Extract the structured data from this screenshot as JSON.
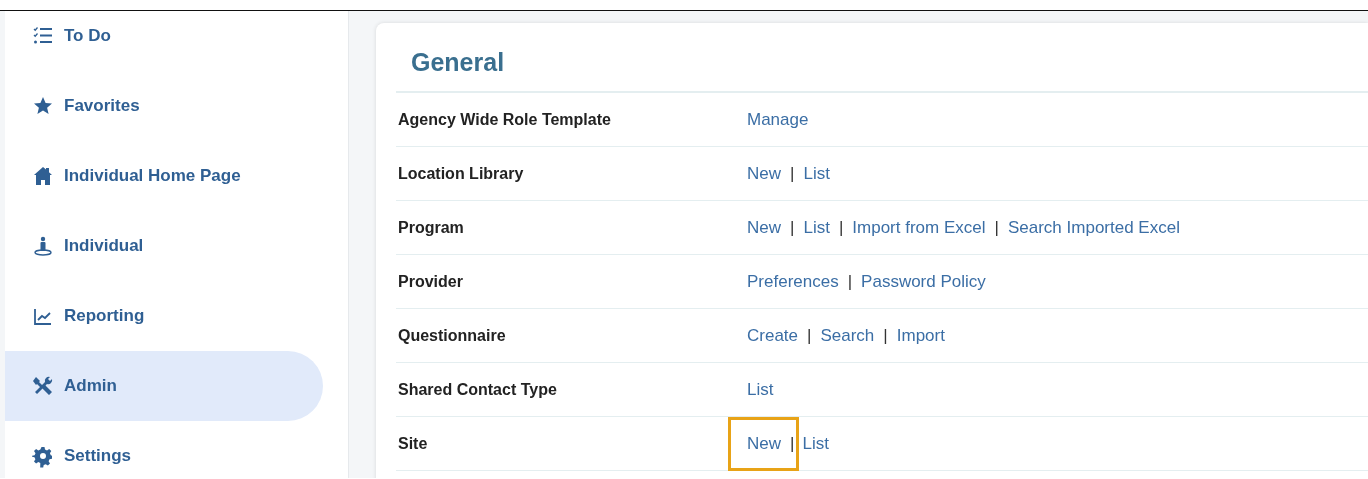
{
  "sidebar": {
    "items": [
      {
        "label": "To Do",
        "selected": false
      },
      {
        "label": "Favorites",
        "selected": false
      },
      {
        "label": "Individual Home Page",
        "selected": false
      },
      {
        "label": "Individual",
        "selected": false
      },
      {
        "label": "Reporting",
        "selected": false
      },
      {
        "label": "Admin",
        "selected": true
      },
      {
        "label": "Settings",
        "selected": false
      }
    ]
  },
  "section": {
    "title": "General",
    "rows": [
      {
        "label": "Agency Wide Role Template",
        "links": [
          {
            "text": "Manage",
            "highlighted": false
          }
        ]
      },
      {
        "label": "Location Library",
        "links": [
          {
            "text": "New",
            "separator_after": "|",
            "highlighted": false
          },
          {
            "text": "List",
            "highlighted": false
          }
        ]
      },
      {
        "label": "Program",
        "links": [
          {
            "text": "New",
            "separator_after": "|",
            "highlighted": false
          },
          {
            "text": "List",
            "separator_after": "|",
            "highlighted": false
          },
          {
            "text": "Import from Excel",
            "separator_after": "|",
            "highlighted": false
          },
          {
            "text": "Search Imported Excel",
            "highlighted": false
          }
        ]
      },
      {
        "label": "Provider",
        "links": [
          {
            "text": "Preferences",
            "separator_after": "|",
            "highlighted": false
          },
          {
            "text": "Password Policy",
            "highlighted": false
          }
        ]
      },
      {
        "label": "Questionnaire",
        "links": [
          {
            "text": "Create",
            "separator_after": "|",
            "highlighted": false
          },
          {
            "text": "Search",
            "separator_after": "|",
            "highlighted": false
          },
          {
            "text": "Import",
            "highlighted": false
          }
        ]
      },
      {
        "label": "Shared Contact Type",
        "links": [
          {
            "text": "List",
            "highlighted": false
          }
        ]
      },
      {
        "label": "Site",
        "links": [
          {
            "text": "New",
            "separator_after": "|",
            "highlighted": true
          },
          {
            "text": "List",
            "highlighted": false
          }
        ]
      }
    ]
  }
}
